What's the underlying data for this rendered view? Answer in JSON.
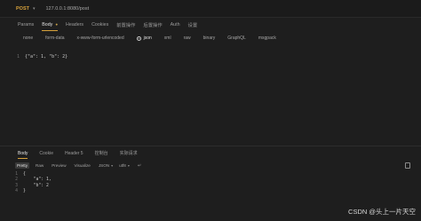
{
  "request": {
    "method": "POST",
    "url": "127.0.0.1:8080/post"
  },
  "request_tabs": [
    {
      "label": "Params",
      "active": false
    },
    {
      "label": "Body",
      "active": true,
      "dot": true
    },
    {
      "label": "Headers",
      "active": false
    },
    {
      "label": "Cookies",
      "active": false
    },
    {
      "label": "前置操作",
      "active": false
    },
    {
      "label": "后置操作",
      "active": false
    },
    {
      "label": "Auth",
      "active": false
    },
    {
      "label": "设置",
      "active": false
    }
  ],
  "body_types": [
    {
      "label": "none",
      "selected": false
    },
    {
      "label": "form-data",
      "selected": false
    },
    {
      "label": "x-www-form-urlencoded",
      "selected": false
    },
    {
      "label": "json",
      "selected": true
    },
    {
      "label": "xml",
      "selected": false
    },
    {
      "label": "raw",
      "selected": false
    },
    {
      "label": "binary",
      "selected": false
    },
    {
      "label": "GraphQL",
      "selected": false
    },
    {
      "label": "msgpack",
      "selected": false
    }
  ],
  "request_body_lines": [
    {
      "num": "1",
      "code": "{\"a\": 1, \"b\": 2}"
    }
  ],
  "response_tabs": [
    {
      "label": "Body",
      "active": true
    },
    {
      "label": "Cookie",
      "active": false
    },
    {
      "label": "Header",
      "count": "5",
      "active": false
    },
    {
      "label": "控制台",
      "active": false
    },
    {
      "label": "实际请求",
      "active": false
    }
  ],
  "format_bar": {
    "buttons": [
      "Pretty",
      "Raw",
      "Preview",
      "Visualize"
    ],
    "active": "Pretty",
    "format_select": "JSON",
    "encoding_select": "utf8"
  },
  "response_body_lines": [
    {
      "num": "1",
      "code": "{"
    },
    {
      "num": "2",
      "code": "    \"a\": 1,"
    },
    {
      "num": "3",
      "code": "    \"b\": 2"
    },
    {
      "num": "4",
      "code": "}"
    }
  ],
  "watermark": "CSDN @头上一片天空"
}
